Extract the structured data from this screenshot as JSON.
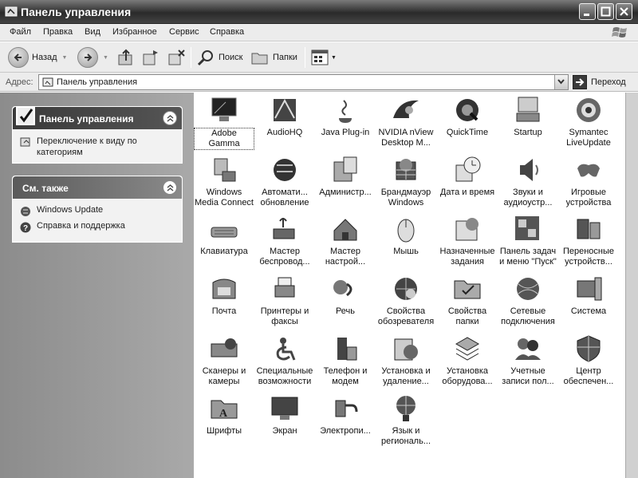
{
  "window": {
    "title": "Панель управления"
  },
  "menu": [
    "Файл",
    "Правка",
    "Вид",
    "Избранное",
    "Сервис",
    "Справка"
  ],
  "toolbar": {
    "back": "Назад",
    "search": "Поиск",
    "folders": "Папки"
  },
  "address": {
    "label": "Адрес:",
    "value": "Панель управления",
    "go": "Переход"
  },
  "left": {
    "panel1": {
      "title": "Панель управления",
      "link": "Переключение к виду по категориям"
    },
    "panel2": {
      "title": "См. также",
      "links": [
        "Windows Update",
        "Справка и поддержка"
      ]
    }
  },
  "items": [
    "Adobe Gamma",
    "AudioHQ",
    "Java Plug-in",
    "NVIDIA nView\nDesktop M...",
    "QuickTime",
    "Startup",
    "Symantec\nLiveUpdate",
    "Windows\nMedia Connect",
    "Автомати...\nобновление",
    "Администр...",
    "Брандмауэр\nWindows",
    "Дата и время",
    "Звуки и\nаудиоустр...",
    "Игровые\nустройства",
    "Клавиатура",
    "Мастер\nбеспровод...",
    "Мастер\nнастрой...",
    "Мышь",
    "Назначенные\nзадания",
    "Панель задач\nи меню \"Пуск\"",
    "Переносные\nустройств...",
    "Почта",
    "Принтеры и\nфаксы",
    "Речь",
    "Свойства\nобозревателя",
    "Свойства\nпапки",
    "Сетевые\nподключения",
    "Система",
    "Сканеры и\nкамеры",
    "Специальные\nвозможности",
    "Телефон и\nмодем",
    "Установка и\nудаление...",
    "Установка\nоборудова...",
    "Учетные\nзаписи пол...",
    "Центр\nобеспечен...",
    "Шрифты",
    "Экран",
    "Электропи...",
    "Язык и\nрегиональ..."
  ]
}
